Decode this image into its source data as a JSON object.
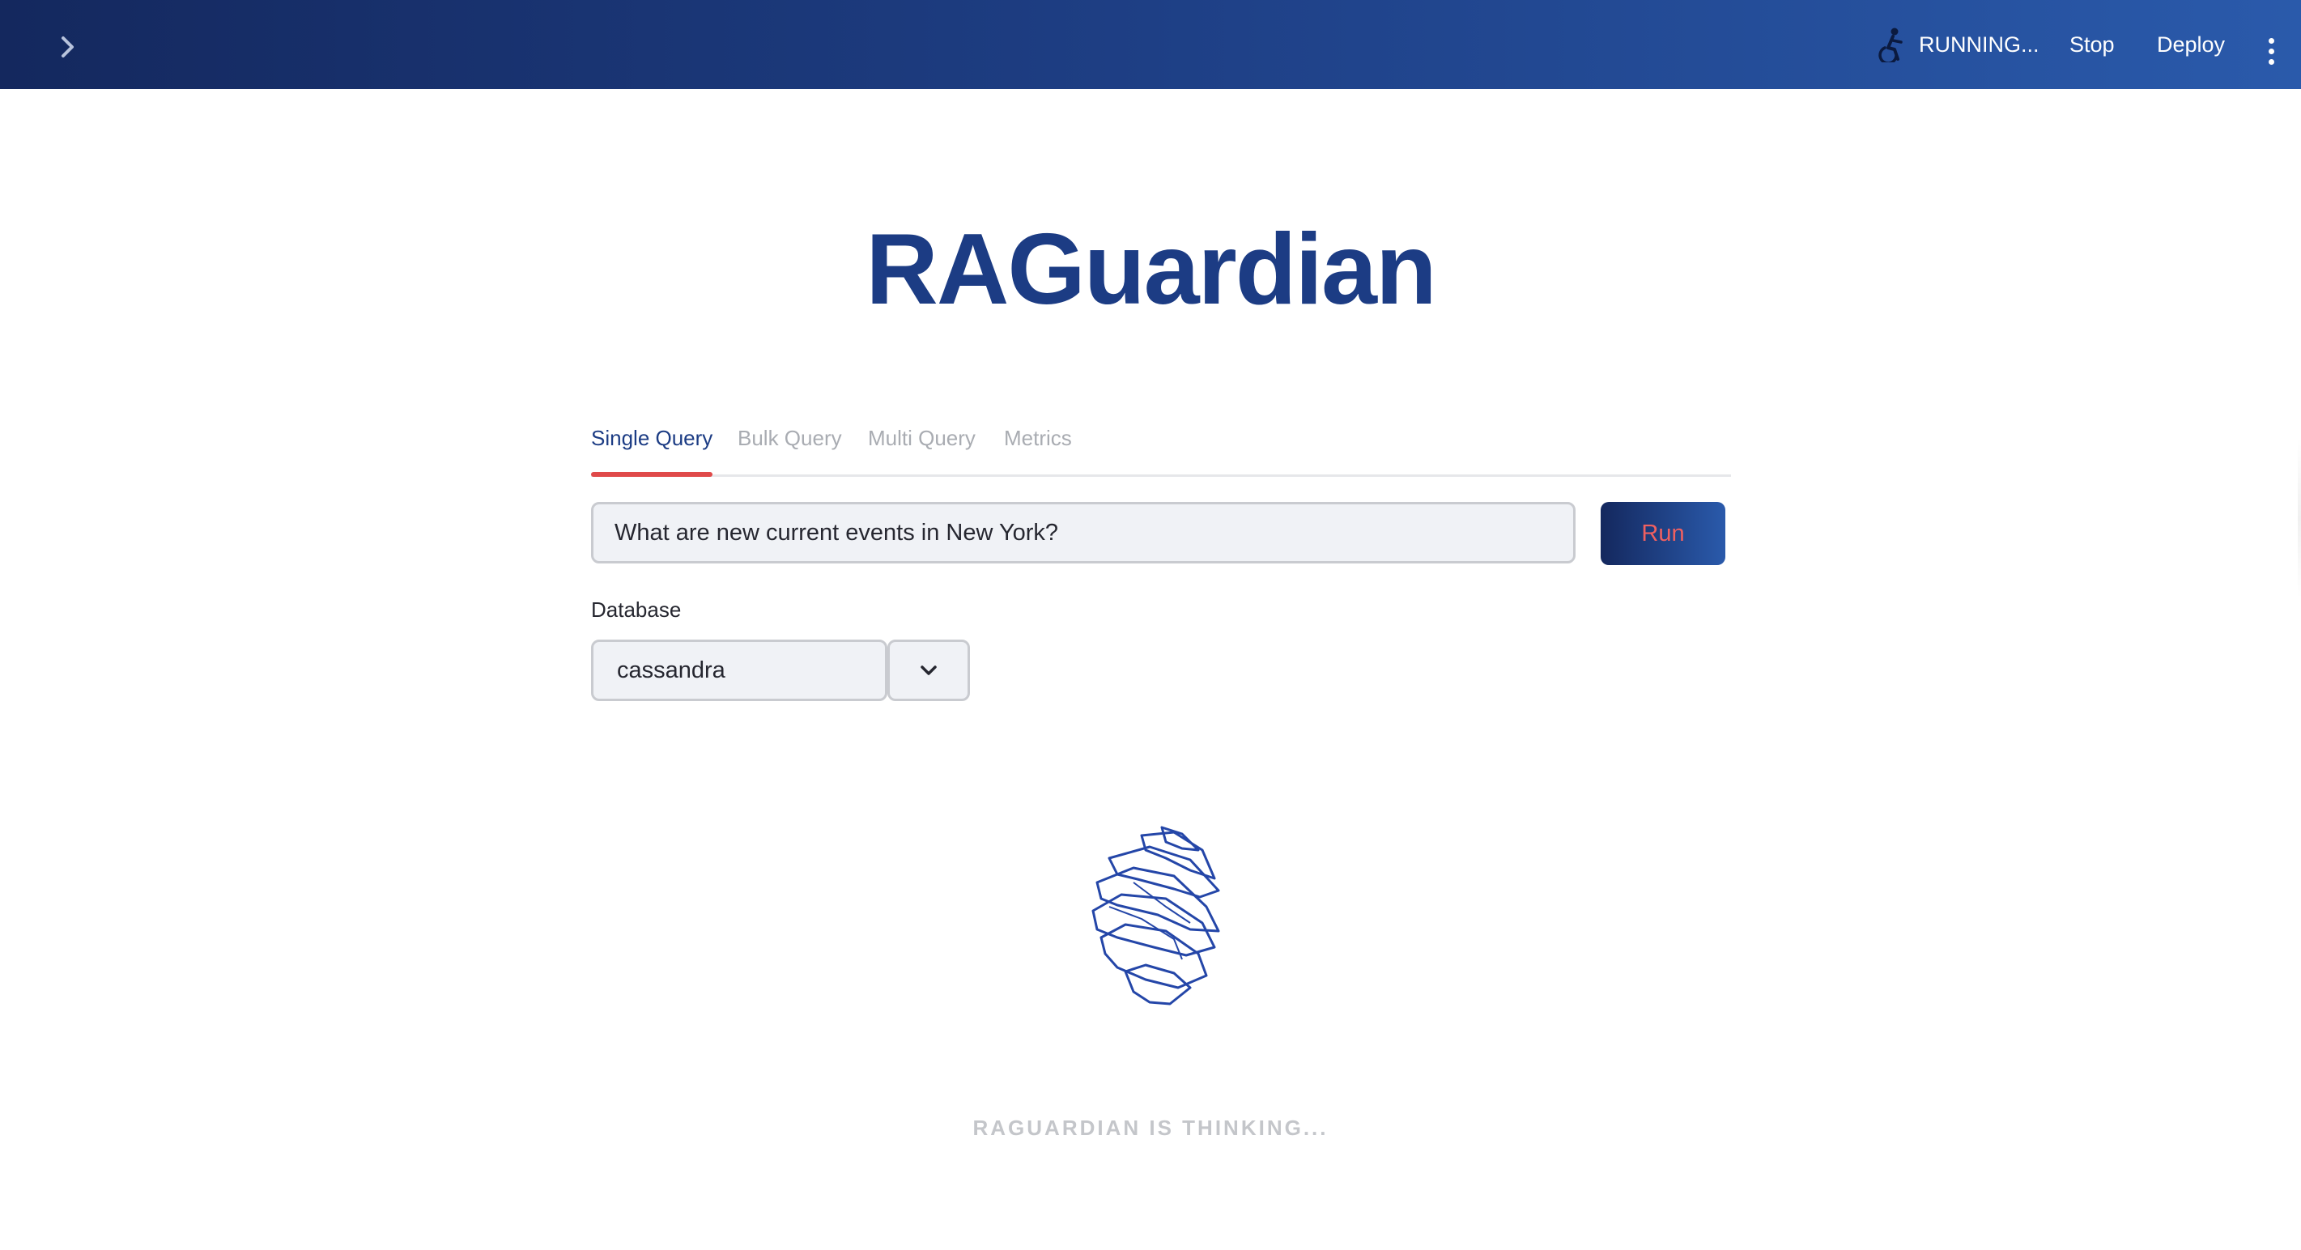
{
  "header": {
    "status_text": "RUNNING...",
    "status_icon": "running-figure-icon",
    "stop_label": "Stop",
    "deploy_label": "Deploy",
    "menu_icon": "vertical-dots-icon",
    "sidebar_toggle_icon": "chevron-right-icon"
  },
  "title": "RAGuardian",
  "tabs": [
    {
      "label": "Single Query",
      "active": true
    },
    {
      "label": "Bulk Query",
      "active": false
    },
    {
      "label": "Multi Query",
      "active": false
    },
    {
      "label": "Metrics",
      "active": false
    }
  ],
  "query": {
    "value": "What are new current events in New York?"
  },
  "run_label": "Run",
  "database": {
    "label": "Database",
    "selected": "cassandra"
  },
  "loading": {
    "text": "RAGUARDIAN IS THINKING..."
  },
  "colors": {
    "accent": "#1c3c84",
    "tab_underline": "#e04a4a",
    "run_text": "#f06060"
  }
}
